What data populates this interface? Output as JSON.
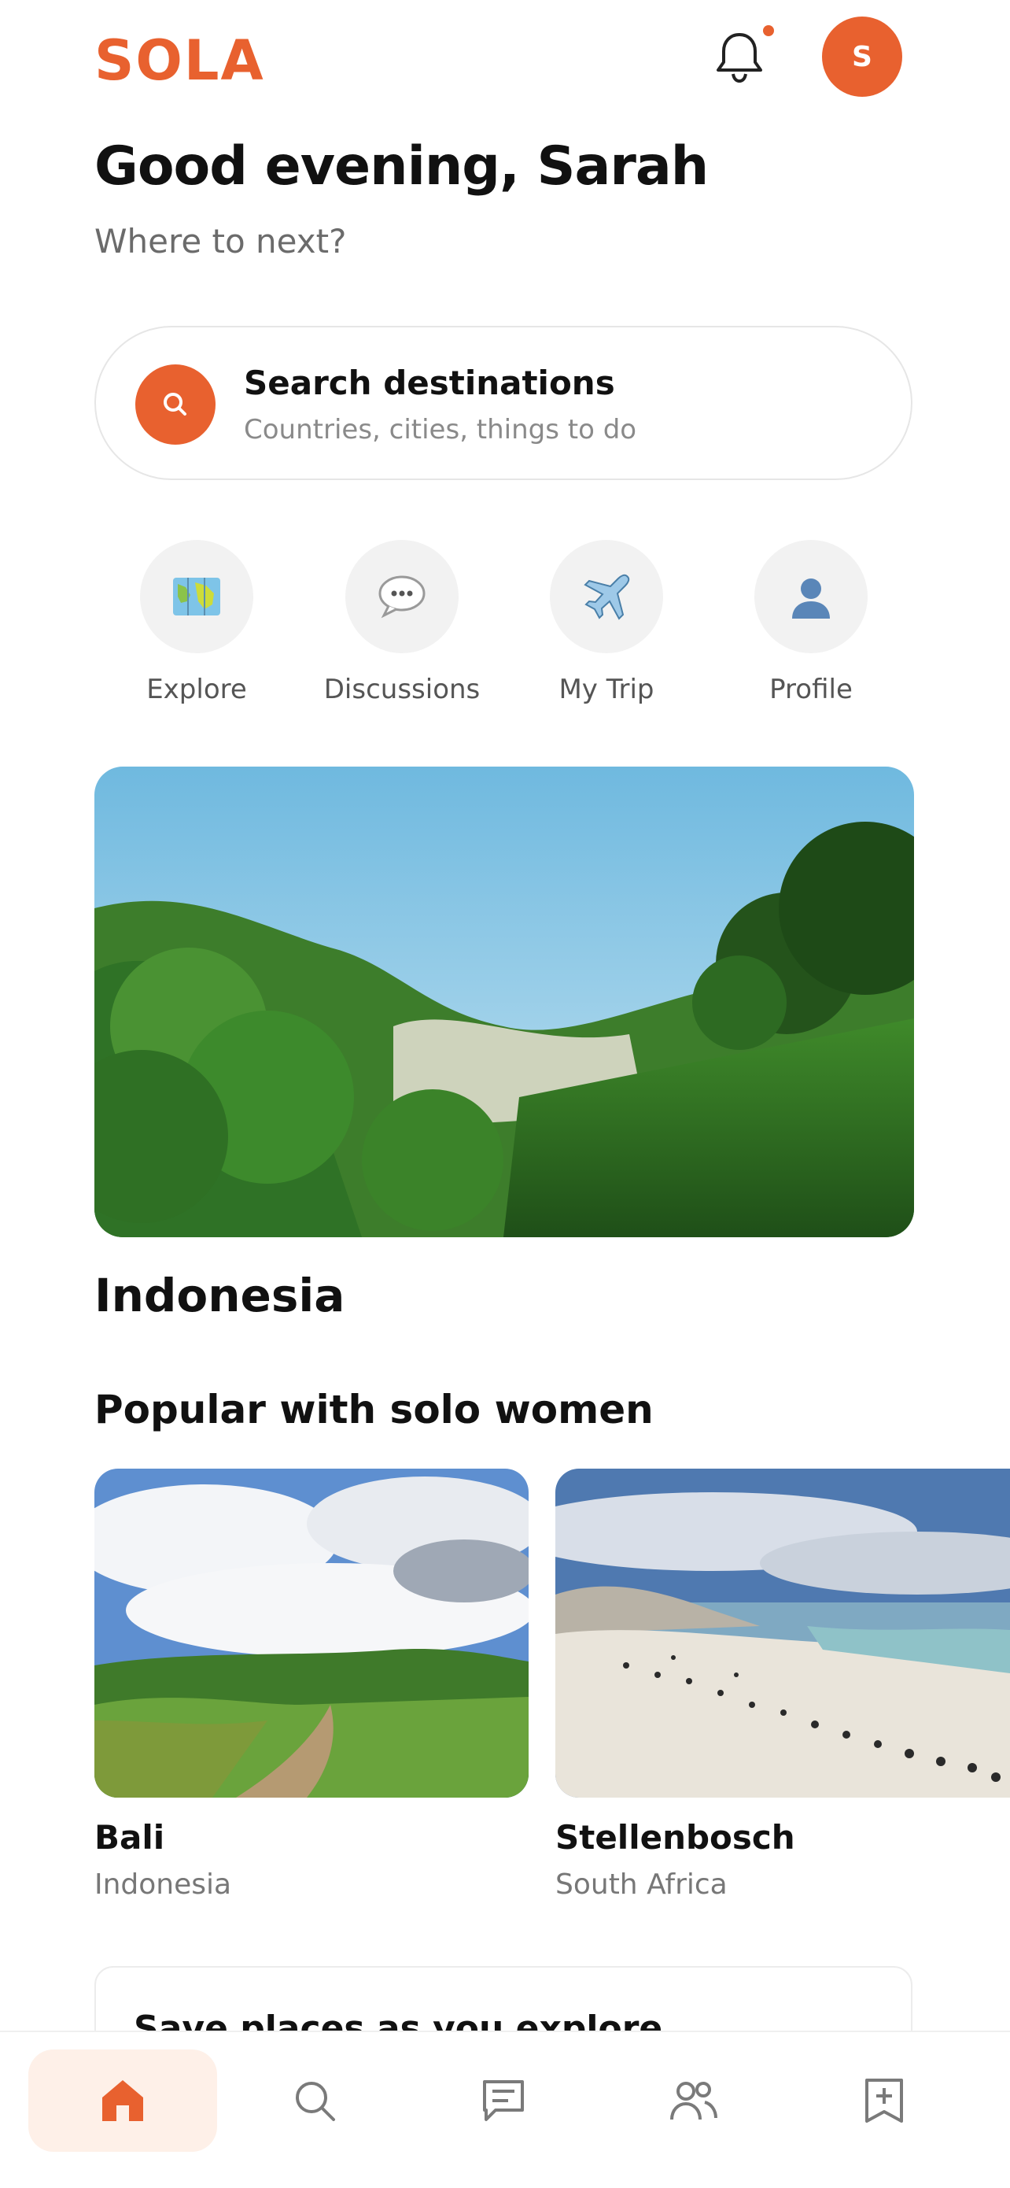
{
  "brand": {
    "logo": "SOLA",
    "accent": "#E8612F",
    "home_tab_bg": "#FEF0E8"
  },
  "header": {
    "avatar_initial": "S",
    "notification_icon": "bell-icon",
    "has_unread": true
  },
  "greeting": {
    "title": "Good evening, Sarah",
    "subtitle": "Where to next?"
  },
  "search": {
    "title": "Search destinations",
    "placeholder": "Countries, cities, things to do",
    "icon": "search-icon"
  },
  "quick_actions": [
    {
      "label": "Explore",
      "icon": "map-icon"
    },
    {
      "label": "Discussions",
      "icon": "speech-bubble-icon"
    },
    {
      "label": "My Trip",
      "icon": "airplane-icon"
    },
    {
      "label": "Profile",
      "icon": "person-icon"
    }
  ],
  "featured": {
    "title": "Indonesia"
  },
  "popular": {
    "title": "Popular with solo women",
    "items": [
      {
        "name": "Bali",
        "country": "Indonesia"
      },
      {
        "name": "Stellenbosch",
        "country": "South Africa"
      }
    ]
  },
  "save_prompt": {
    "title": "Save places as you explore"
  },
  "tabs": [
    {
      "icon": "home-icon",
      "active": true
    },
    {
      "icon": "search-icon",
      "active": false
    },
    {
      "icon": "chat-icon",
      "active": false
    },
    {
      "icon": "people-icon",
      "active": false
    },
    {
      "icon": "bookmark-add-icon",
      "active": false
    }
  ]
}
